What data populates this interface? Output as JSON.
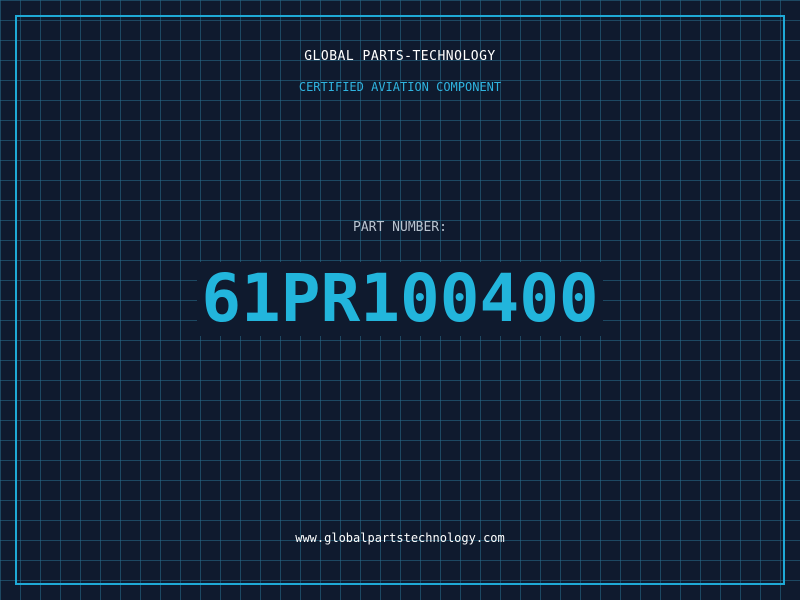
{
  "header": {
    "company": "GLOBAL PARTS-TECHNOLOGY",
    "subtitle": "CERTIFIED AVIATION COMPONENT"
  },
  "part": {
    "label": "PART NUMBER:",
    "number": "61PR100400"
  },
  "footer": {
    "website": "www.globalpartstechnology.com"
  },
  "colors": {
    "background": "#0f1a2e",
    "grid": "#286e8c",
    "frame": "#1fa9d6",
    "accent": "#22b5dc",
    "label": "#b9c3cf",
    "text": "#ffffff"
  }
}
